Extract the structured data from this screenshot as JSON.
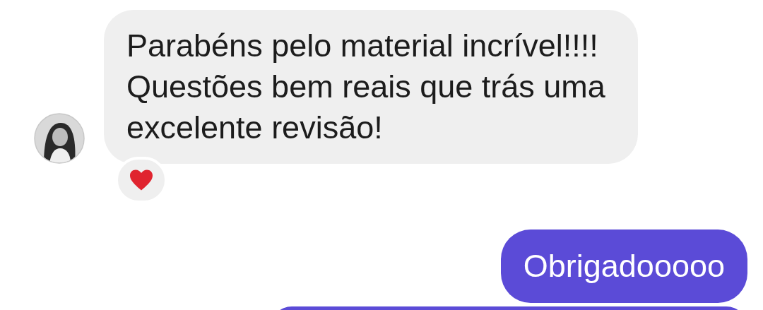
{
  "messages": [
    {
      "kind": "incoming",
      "text": "Parabéns pelo material incrível!!!! Questões bem reais que trás uma excelente revisão!",
      "reaction": {
        "kind": "heart"
      }
    },
    {
      "kind": "outgoing",
      "text": "Obrigadooooo"
    },
    {
      "kind": "outgoing"
    }
  ]
}
